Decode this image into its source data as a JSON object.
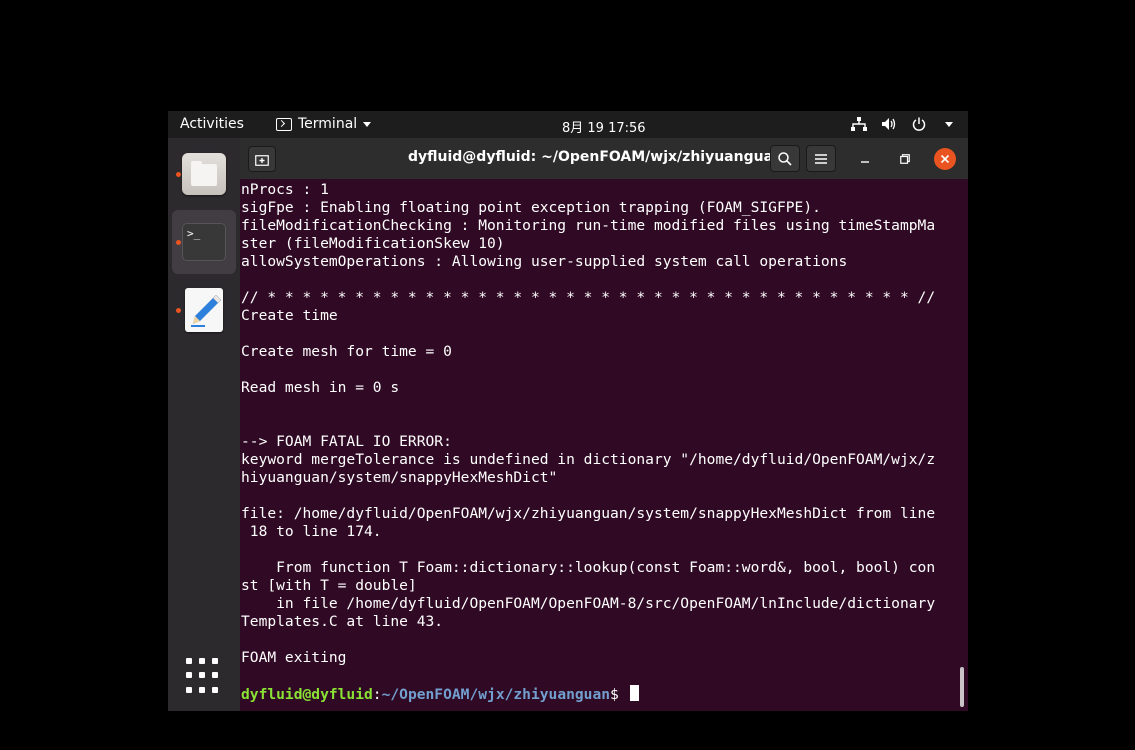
{
  "topbar": {
    "activities": "Activities",
    "app_menu_label": "Terminal",
    "clock": "8月 19  17:56",
    "tray_icons": [
      "network-icon",
      "volume-icon",
      "power-icon",
      "chevron-down-icon"
    ]
  },
  "dock": {
    "items": [
      {
        "name": "Files",
        "icon": "folder-icon",
        "running": true
      },
      {
        "name": "Terminal",
        "icon": "terminal-icon",
        "running": true,
        "active": true
      },
      {
        "name": "Text Editor",
        "icon": "text-editor-icon",
        "running": true
      }
    ],
    "show_apps_icon": "app-grid-icon"
  },
  "window": {
    "title": "dyfluid@dyfluid: ~/OpenFOAM/wjx/zhiyuanguan",
    "buttons": [
      "new-tab-icon",
      "search-icon",
      "hamburger-menu-icon",
      "minimize-icon",
      "restore-icon",
      "close-icon"
    ]
  },
  "terminal": {
    "lines": [
      "nProcs : 1",
      "sigFpe : Enabling floating point exception trapping (FOAM_SIGFPE).",
      "fileModificationChecking : Monitoring run-time modified files using timeStampMa",
      "ster (fileModificationSkew 10)",
      "allowSystemOperations : Allowing user-supplied system call operations",
      "",
      "// * * * * * * * * * * * * * * * * * * * * * * * * * * * * * * * * * * * * * //",
      "Create time",
      "",
      "Create mesh for time = 0",
      "",
      "Read mesh in = 0 s",
      "",
      "",
      "--> FOAM FATAL IO ERROR:",
      "keyword mergeTolerance is undefined in dictionary \"/home/dyfluid/OpenFOAM/wjx/z",
      "hiyuanguan/system/snappyHexMeshDict\"",
      "",
      "file: /home/dyfluid/OpenFOAM/wjx/zhiyuanguan/system/snappyHexMeshDict from line",
      " 18 to line 174.",
      "",
      "    From function T Foam::dictionary::lookup(const Foam::word&, bool, bool) con",
      "st [with T = double]",
      "    in file /home/dyfluid/OpenFOAM/OpenFOAM-8/src/OpenFOAM/lnInclude/dictionary",
      "Templates.C at line 43.",
      "",
      "FOAM exiting",
      ""
    ],
    "prompt_user": "dyfluid@dyfluid",
    "prompt_sep": ":",
    "prompt_path": "~/OpenFOAM/wjx/zhiyuanguan",
    "prompt_symbol": "$ "
  },
  "colors": {
    "terminal_bg": "#300a24",
    "prompt_user": "#8ae234",
    "prompt_path": "#729fcf",
    "accent": "#e95420"
  }
}
